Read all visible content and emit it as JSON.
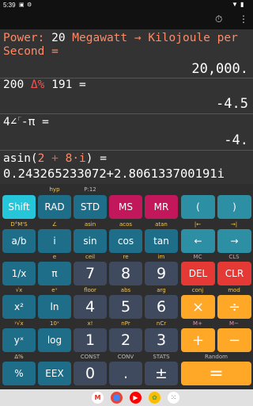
{
  "status_bar": {
    "time": "5:39"
  },
  "display": {
    "line1_prefix": "Power: ",
    "line1_num": "20",
    "line1_unit": " Megawatt → Kilojoule per",
    "line1_cont": "Second =",
    "line1_result": "20,000.",
    "line2_a": "200 ",
    "line2_op": "Δ%",
    "line2_b": " 191 =",
    "line2_result": "-4.5",
    "line3_a": "4",
    "line3_angle": "∠",
    "line3_r": "r",
    "line3_b": "-π =",
    "line3_result": "-4.",
    "line4_pre": "asin(",
    "line4_a": "2",
    "line4_plus": " + ",
    "line4_b": "8·i",
    "line4_post": ") =",
    "line4_result": "0.243265233072+2.806133700191i"
  },
  "keypad": {
    "row0_labels": [
      "hyp",
      "P:12"
    ],
    "row0_keys": [
      "Shift",
      "RAD",
      "STD",
      "MS",
      "MR",
      "(",
      ")"
    ],
    "row1_labels": [
      "D°M'S",
      "∠",
      "asin",
      "acos",
      "atan",
      "|←",
      "→|"
    ],
    "row1_keys": [
      "a/b",
      "i",
      "sin",
      "cos",
      "tan",
      "←",
      "→"
    ],
    "row2_labels": [
      "e",
      "ceil",
      "re",
      "im",
      "MC",
      "CLS"
    ],
    "row2_keys": [
      "1/x",
      "π",
      "7",
      "8",
      "9",
      "DEL",
      "CLR"
    ],
    "row3_labels": [
      "√x",
      "eˣ",
      "floor",
      "abs",
      "arg",
      "conj",
      "mod"
    ],
    "row3_keys": [
      "x²",
      "ln",
      "4",
      "5",
      "6",
      "×",
      "÷"
    ],
    "row4_labels": [
      "ʸ√x",
      "10ˣ",
      "x!",
      "nPr",
      "nCr",
      "M+",
      "M−"
    ],
    "row4_keys": [
      "yˣ",
      "log",
      "1",
      "2",
      "3",
      "+",
      "−"
    ],
    "row5_labels": [
      "Δ%",
      "CONST",
      "CONV",
      "STATS",
      "Random"
    ],
    "row5_keys": [
      "%",
      "EEX",
      "0",
      ".",
      "±",
      "="
    ]
  },
  "colors": {
    "shift": "#26c6da",
    "function_key": "#1e6e8a",
    "memory_key": "#c2185b",
    "number_key": "#404a5e",
    "delete_key": "#e53935",
    "operator_key": "#ffa726"
  }
}
